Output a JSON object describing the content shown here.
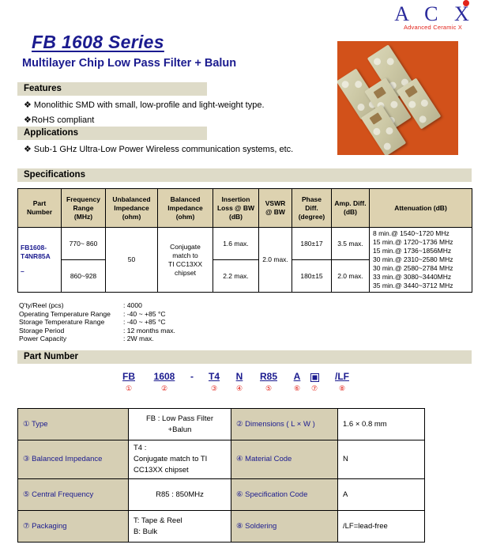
{
  "logo": {
    "letters": "A C X",
    "tagline": "Advanced Ceramic X",
    "dot_color": "#e2231a",
    "letters_color": "#2b2b9c"
  },
  "title": {
    "main": "FB 1608 Series",
    "sub": "Multilayer Chip Low Pass Filter + Balun",
    "color": "#1b1b8f"
  },
  "sections": {
    "features": "Features",
    "applications": "Applications",
    "specifications": "Specifications",
    "part_number": "Part Number"
  },
  "features": [
    "❖ Monolithic SMD with small, low-profile and light-weight type.",
    "❖RoHS compliant"
  ],
  "applications": [
    "❖ Sub-1 GHz Ultra-Low Power Wireless communication systems, etc."
  ],
  "product_image": {
    "background_color": "#d2511a",
    "chip_color": "#cdc9a6",
    "alt": "five beige multilayer chip components on orange background"
  },
  "spec_table": {
    "headers": [
      "Part\nNumber",
      "Frequency\nRange\n(MHz)",
      "Unbalanced\nImpedance\n(ohm)",
      "Balanced\nImpedance\n(ohm)",
      "Insertion\nLoss @ BW\n(dB)",
      "VSWR\n@ BW",
      "Phase\nDiff.\n(degree)",
      "Amp. Diff.\n(dB)",
      "Attenuation (dB)"
    ],
    "headers_flat": {
      "part_number": "Part Number",
      "frequency_range": "Frequency Range (MHz)",
      "unbalanced_impedance": "Unbalanced Impedance (ohm)",
      "balanced_impedance": "Balanced Impedance (ohm)",
      "insertion_loss": "Insertion Loss @ BW (dB)",
      "vswr": "VSWR @ BW",
      "phase_diff": "Phase Diff. (degree)",
      "amp_diff": "Amp. Diff. (dB)",
      "attenuation": "Attenuation (dB)"
    },
    "part_number_line1": "FB1608-",
    "part_number_line2": "T4NR85A",
    "part_number_line3": "–",
    "unbalanced_impedance": "50",
    "balanced_impedance_l1": "Conjugate",
    "balanced_impedance_l2": "match to",
    "balanced_impedance_l3": "TI CC13XX",
    "balanced_impedance_l4": "chipset",
    "vswr": "2.0 max.",
    "rows": [
      {
        "frequency_range": "770~ 860",
        "insertion_loss": "1.6 max.",
        "phase_diff": "180±17",
        "amp_diff": "3.5 max."
      },
      {
        "frequency_range": "860~928",
        "insertion_loss": "2.2 max.",
        "phase_diff": "180±15",
        "amp_diff": "2.0 max."
      }
    ],
    "attenuation_top": [
      "8 min.@ 1540~1720 MHz",
      "15 min.@ 1720~1736 MHz",
      "15 min.@ 1736~1856MHz"
    ],
    "attenuation_bottom": [
      "30 min.@ 2310~2580 MHz",
      "30 min.@ 2580~2784 MHz",
      "33 min.@ 3080~3440MHz",
      "35 min.@ 3440~3712 MHz"
    ]
  },
  "notes": [
    {
      "label": "Q'ty/Reel (pcs)",
      "value": ": 4000"
    },
    {
      "label": "Operating Temperature Range",
      "value": ": -40 ~ +85 °C"
    },
    {
      "label": "Storage Temperature Range",
      "value": ": -40 ~ +85 °C"
    },
    {
      "label": "Storage Period",
      "value": ": 12 months max."
    },
    {
      "label": "Power Capacity",
      "value": ": 2W max."
    }
  ],
  "part_number_code": {
    "tokens": [
      {
        "text": "FB",
        "index": "①"
      },
      {
        "text": "1608",
        "index": "②"
      },
      {
        "text": "-",
        "index": ""
      },
      {
        "text": "T4",
        "index": "③"
      },
      {
        "text": "N",
        "index": "④"
      },
      {
        "text": "R85",
        "index": "⑤"
      },
      {
        "text": "A",
        "index": "⑥"
      },
      {
        "text": "■",
        "index": "⑦"
      },
      {
        "text": "/LF",
        "index": "⑧"
      }
    ]
  },
  "part_number_table": {
    "rows": [
      {
        "left_label": "① Type",
        "left_value_l1": "FB : Low Pass Filter",
        "left_value_l2": "+Balun",
        "right_label": "② Dimensions ( L × W )",
        "right_value": "1.6 × 0.8 mm"
      },
      {
        "left_label": "③ Balanced Impedance",
        "left_value_l1": "T4 :",
        "left_value_l2": "Conjugate match to TI",
        "left_value_l3": "CC13XX chipset",
        "right_label": "④ Material Code",
        "right_value": "N"
      },
      {
        "left_label": "⑤ Central Frequency",
        "left_value_l1": "R85 : 850MHz",
        "right_label": "⑥ Specification Code",
        "right_value": "A"
      },
      {
        "left_label": "⑦ Packaging",
        "left_value_l1": "T: Tape & Reel",
        "left_value_l2": "B: Bulk",
        "right_label": "⑧ Soldering",
        "right_value": "/LF=lead-free"
      }
    ]
  }
}
